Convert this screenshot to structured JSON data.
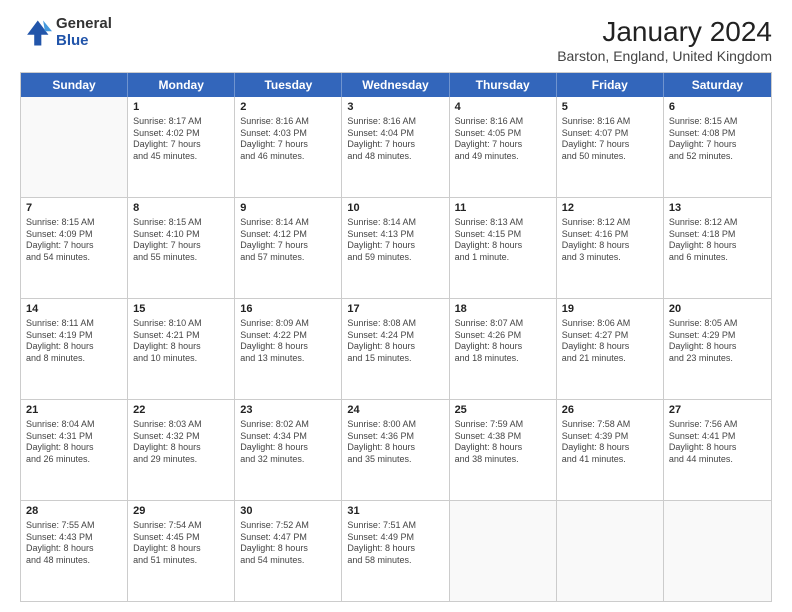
{
  "header": {
    "logo_general": "General",
    "logo_blue": "Blue",
    "title": "January 2024",
    "subtitle": "Barston, England, United Kingdom"
  },
  "days_of_week": [
    "Sunday",
    "Monday",
    "Tuesday",
    "Wednesday",
    "Thursday",
    "Friday",
    "Saturday"
  ],
  "weeks": [
    [
      {
        "day": "",
        "info": ""
      },
      {
        "day": "1",
        "info": "Sunrise: 8:17 AM\nSunset: 4:02 PM\nDaylight: 7 hours\nand 45 minutes."
      },
      {
        "day": "2",
        "info": "Sunrise: 8:16 AM\nSunset: 4:03 PM\nDaylight: 7 hours\nand 46 minutes."
      },
      {
        "day": "3",
        "info": "Sunrise: 8:16 AM\nSunset: 4:04 PM\nDaylight: 7 hours\nand 48 minutes."
      },
      {
        "day": "4",
        "info": "Sunrise: 8:16 AM\nSunset: 4:05 PM\nDaylight: 7 hours\nand 49 minutes."
      },
      {
        "day": "5",
        "info": "Sunrise: 8:16 AM\nSunset: 4:07 PM\nDaylight: 7 hours\nand 50 minutes."
      },
      {
        "day": "6",
        "info": "Sunrise: 8:15 AM\nSunset: 4:08 PM\nDaylight: 7 hours\nand 52 minutes."
      }
    ],
    [
      {
        "day": "7",
        "info": "Sunrise: 8:15 AM\nSunset: 4:09 PM\nDaylight: 7 hours\nand 54 minutes."
      },
      {
        "day": "8",
        "info": "Sunrise: 8:15 AM\nSunset: 4:10 PM\nDaylight: 7 hours\nand 55 minutes."
      },
      {
        "day": "9",
        "info": "Sunrise: 8:14 AM\nSunset: 4:12 PM\nDaylight: 7 hours\nand 57 minutes."
      },
      {
        "day": "10",
        "info": "Sunrise: 8:14 AM\nSunset: 4:13 PM\nDaylight: 7 hours\nand 59 minutes."
      },
      {
        "day": "11",
        "info": "Sunrise: 8:13 AM\nSunset: 4:15 PM\nDaylight: 8 hours\nand 1 minute."
      },
      {
        "day": "12",
        "info": "Sunrise: 8:12 AM\nSunset: 4:16 PM\nDaylight: 8 hours\nand 3 minutes."
      },
      {
        "day": "13",
        "info": "Sunrise: 8:12 AM\nSunset: 4:18 PM\nDaylight: 8 hours\nand 6 minutes."
      }
    ],
    [
      {
        "day": "14",
        "info": "Sunrise: 8:11 AM\nSunset: 4:19 PM\nDaylight: 8 hours\nand 8 minutes."
      },
      {
        "day": "15",
        "info": "Sunrise: 8:10 AM\nSunset: 4:21 PM\nDaylight: 8 hours\nand 10 minutes."
      },
      {
        "day": "16",
        "info": "Sunrise: 8:09 AM\nSunset: 4:22 PM\nDaylight: 8 hours\nand 13 minutes."
      },
      {
        "day": "17",
        "info": "Sunrise: 8:08 AM\nSunset: 4:24 PM\nDaylight: 8 hours\nand 15 minutes."
      },
      {
        "day": "18",
        "info": "Sunrise: 8:07 AM\nSunset: 4:26 PM\nDaylight: 8 hours\nand 18 minutes."
      },
      {
        "day": "19",
        "info": "Sunrise: 8:06 AM\nSunset: 4:27 PM\nDaylight: 8 hours\nand 21 minutes."
      },
      {
        "day": "20",
        "info": "Sunrise: 8:05 AM\nSunset: 4:29 PM\nDaylight: 8 hours\nand 23 minutes."
      }
    ],
    [
      {
        "day": "21",
        "info": "Sunrise: 8:04 AM\nSunset: 4:31 PM\nDaylight: 8 hours\nand 26 minutes."
      },
      {
        "day": "22",
        "info": "Sunrise: 8:03 AM\nSunset: 4:32 PM\nDaylight: 8 hours\nand 29 minutes."
      },
      {
        "day": "23",
        "info": "Sunrise: 8:02 AM\nSunset: 4:34 PM\nDaylight: 8 hours\nand 32 minutes."
      },
      {
        "day": "24",
        "info": "Sunrise: 8:00 AM\nSunset: 4:36 PM\nDaylight: 8 hours\nand 35 minutes."
      },
      {
        "day": "25",
        "info": "Sunrise: 7:59 AM\nSunset: 4:38 PM\nDaylight: 8 hours\nand 38 minutes."
      },
      {
        "day": "26",
        "info": "Sunrise: 7:58 AM\nSunset: 4:39 PM\nDaylight: 8 hours\nand 41 minutes."
      },
      {
        "day": "27",
        "info": "Sunrise: 7:56 AM\nSunset: 4:41 PM\nDaylight: 8 hours\nand 44 minutes."
      }
    ],
    [
      {
        "day": "28",
        "info": "Sunrise: 7:55 AM\nSunset: 4:43 PM\nDaylight: 8 hours\nand 48 minutes."
      },
      {
        "day": "29",
        "info": "Sunrise: 7:54 AM\nSunset: 4:45 PM\nDaylight: 8 hours\nand 51 minutes."
      },
      {
        "day": "30",
        "info": "Sunrise: 7:52 AM\nSunset: 4:47 PM\nDaylight: 8 hours\nand 54 minutes."
      },
      {
        "day": "31",
        "info": "Sunrise: 7:51 AM\nSunset: 4:49 PM\nDaylight: 8 hours\nand 58 minutes."
      },
      {
        "day": "",
        "info": ""
      },
      {
        "day": "",
        "info": ""
      },
      {
        "day": "",
        "info": ""
      }
    ]
  ]
}
